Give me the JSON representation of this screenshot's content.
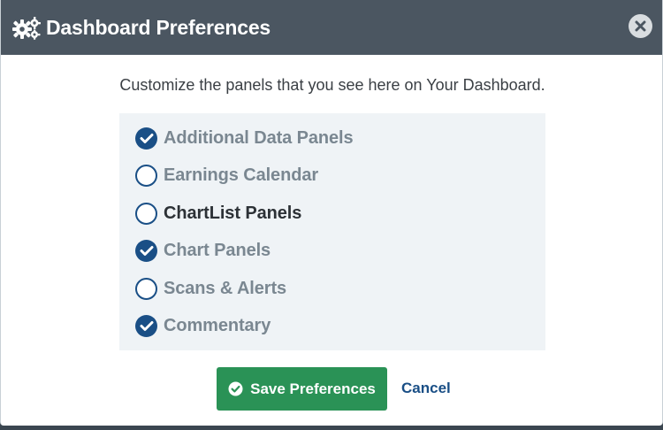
{
  "dialog": {
    "title": "Dashboard Preferences",
    "intro": "Customize the panels that you see here on Your Dashboard.",
    "header_icon": "gears-icon",
    "close_icon": "close-icon"
  },
  "options": [
    {
      "label": "Additional Data Panels",
      "checked": true
    },
    {
      "label": "Earnings Calendar",
      "checked": false
    },
    {
      "label": "ChartList Panels",
      "checked": false
    },
    {
      "label": "Chart Panels",
      "checked": true
    },
    {
      "label": "Scans & Alerts",
      "checked": false
    },
    {
      "label": "Commentary",
      "checked": true
    }
  ],
  "actions": {
    "save_label": "Save Preferences",
    "save_icon": "check-circle-icon",
    "cancel_label": "Cancel"
  },
  "colors": {
    "header": "#4b5661",
    "accent": "#1a4f86",
    "save_button": "#2a9256",
    "panel_background": "#eff3f6"
  }
}
